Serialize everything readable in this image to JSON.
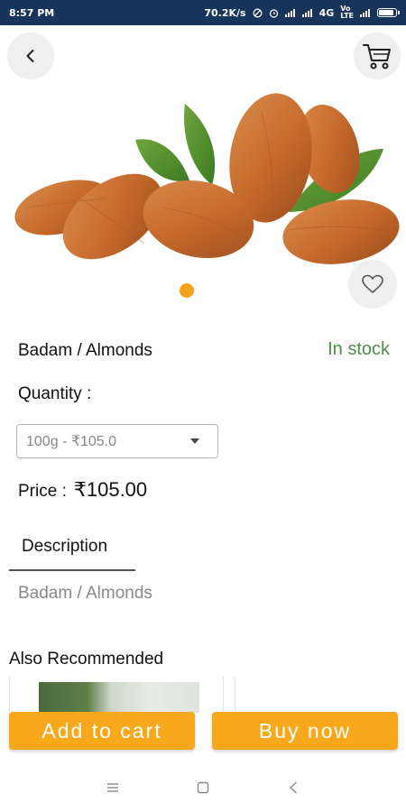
{
  "status_bar": {
    "time": "8:57 PM",
    "speed": "70.2K/s",
    "network": "4G",
    "volte": "VoLTE"
  },
  "icons": {
    "back": "chevron-left-icon",
    "cart": "cart-icon",
    "heart": "heart-outline-icon"
  },
  "colors": {
    "status_bar_bg": "#17345a",
    "accent": "#f7a81b",
    "in_stock": "#4f8a4a",
    "pager_dot": "#f4a21c"
  },
  "product": {
    "name": "Badam / Almonds",
    "stock_status": "In stock",
    "quantity_label": "Quantity :",
    "selected_option": "100g - ₹105.0",
    "price_label": "Price :",
    "price_value": "₹105.00"
  },
  "tabs": {
    "description_label": "Description",
    "description_text": "Badam / Almonds"
  },
  "recommended": {
    "heading": "Also Recommended"
  },
  "actions": {
    "add_to_cart": "Add to cart",
    "buy_now": "Buy now"
  },
  "nav": {
    "menu": "menu-icon",
    "home": "home-square-icon",
    "back": "back-triangle-icon"
  }
}
